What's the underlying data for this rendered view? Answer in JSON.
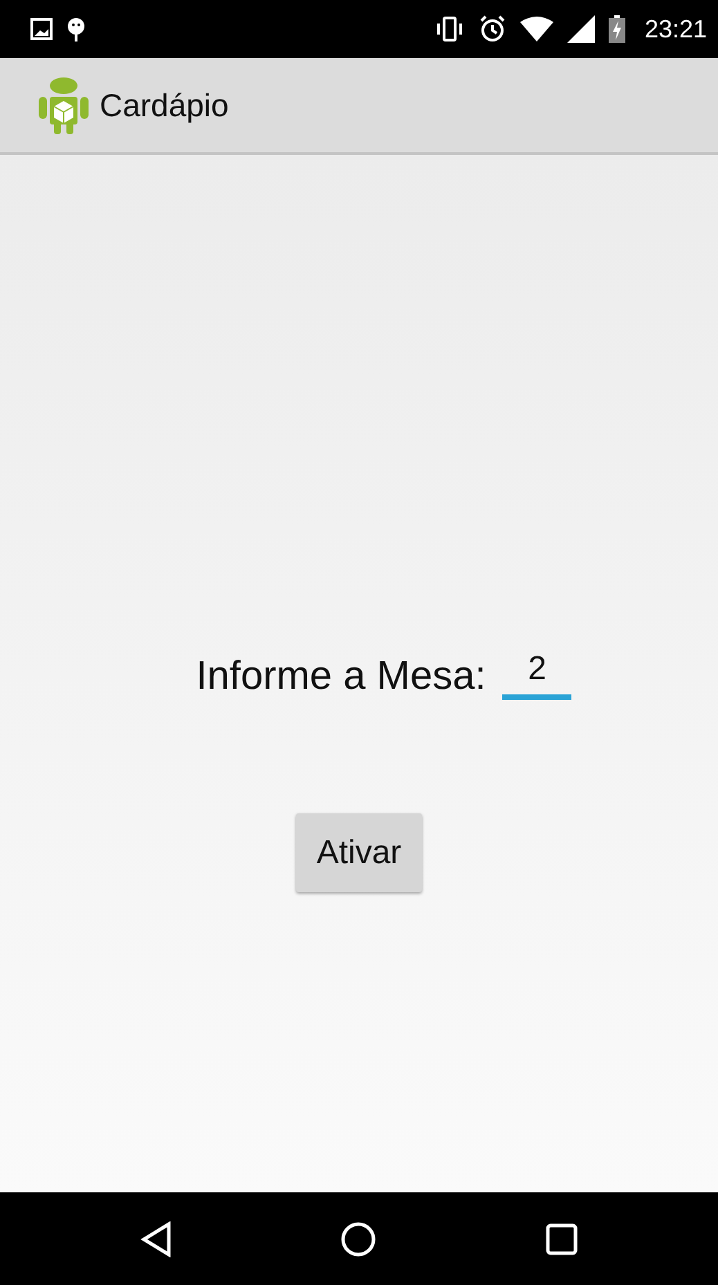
{
  "status_bar": {
    "time": "23:21"
  },
  "app_bar": {
    "title": "Cardápio"
  },
  "form": {
    "label": "Informe a Mesa:",
    "value": "2"
  },
  "buttons": [
    "Ativar"
  ]
}
